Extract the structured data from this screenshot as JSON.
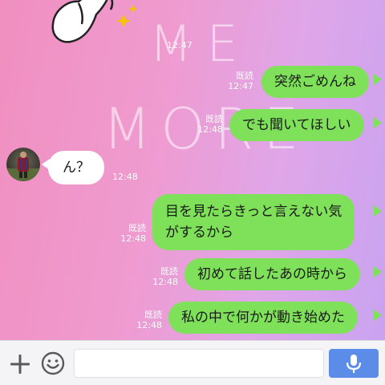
{
  "wallpaper": {
    "line1": "ME",
    "line2": "MORE"
  },
  "messages": [
    {
      "id": "m1",
      "direction": "out",
      "text": "突然ごめんね",
      "read": "既読",
      "time": "12:47"
    },
    {
      "id": "m2",
      "direction": "out",
      "text": "でも聞いてほしい",
      "read": "既読",
      "time": "12:48"
    },
    {
      "id": "m3",
      "direction": "in",
      "text": "ん？",
      "time": "12:48"
    },
    {
      "id": "m4",
      "direction": "out",
      "text_line1": "目を見たらきっと言えない気",
      "text_line2": "がするから",
      "read": "既読",
      "time": "12:48"
    },
    {
      "id": "m5",
      "direction": "out",
      "text": "初めて話したあの時から",
      "read": "既読",
      "time": "12:48"
    },
    {
      "id": "m6",
      "direction": "out",
      "text": "私の中で何かが動き始めた",
      "read": "既読",
      "time": "12:48"
    }
  ],
  "sticker": {
    "time": "12:47"
  },
  "input": {
    "placeholder": "",
    "value": ""
  },
  "colors": {
    "outgoing_bubble": "#7fe05a",
    "incoming_bubble": "#ffffff",
    "mic_button": "#5b8de8"
  },
  "icons": {
    "plus": "plus-icon",
    "emoji": "emoji-icon",
    "mic": "microphone-icon",
    "sparkle": "sparkle-icon"
  }
}
